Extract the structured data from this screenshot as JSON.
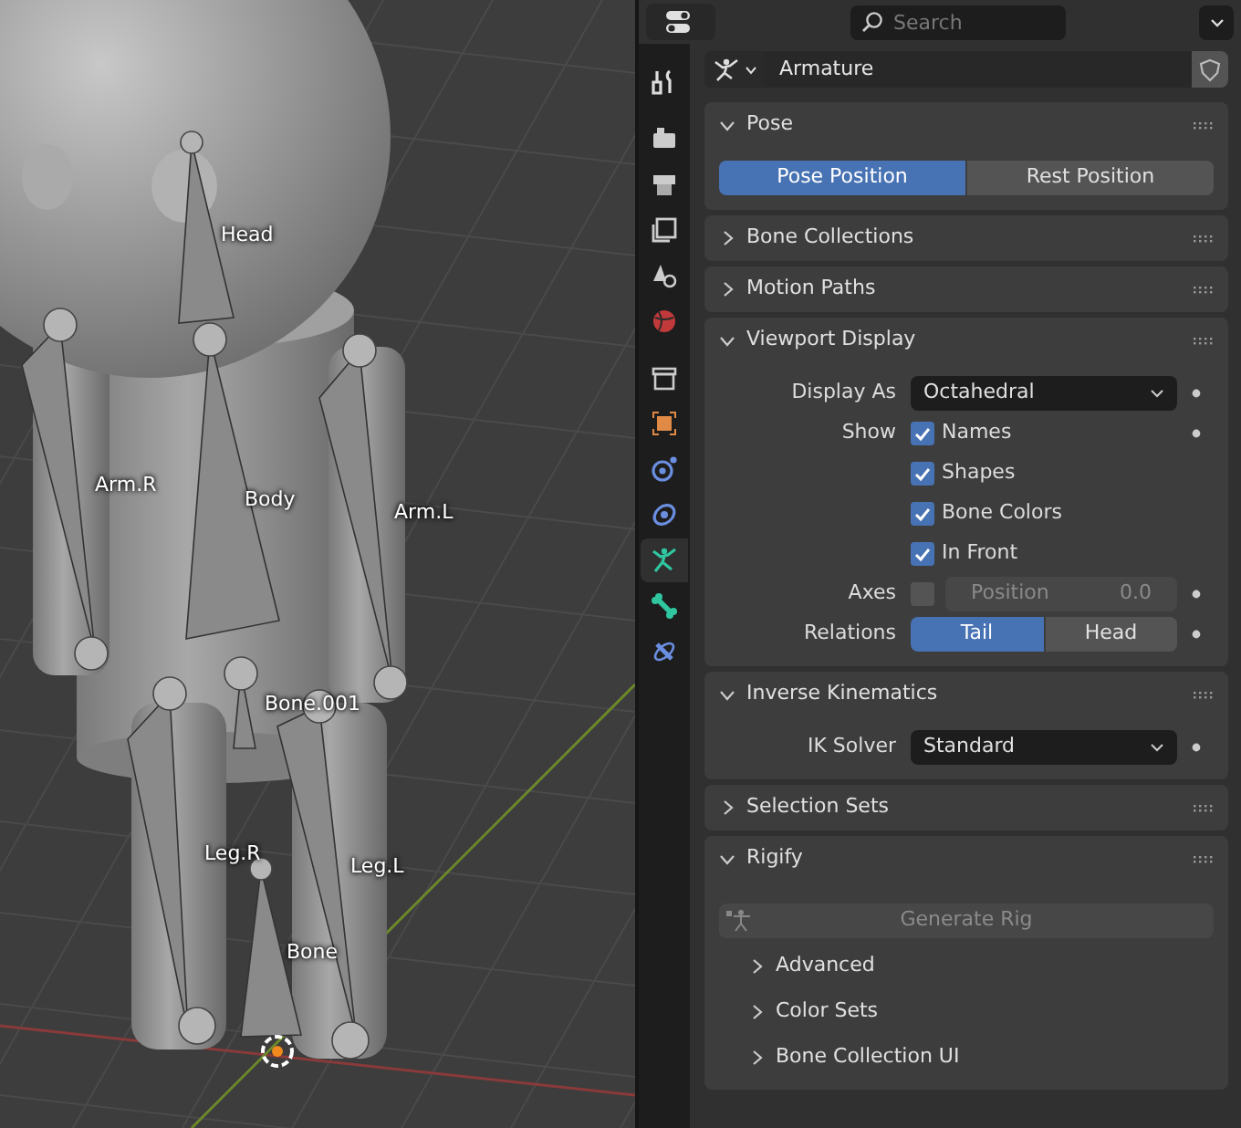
{
  "viewport": {
    "bone_labels": [
      {
        "text": "Head"
      },
      {
        "text": "Arm.R"
      },
      {
        "text": "Body"
      },
      {
        "text": "Arm.L"
      },
      {
        "text": "Bone.001"
      },
      {
        "text": "Leg.R"
      },
      {
        "text": "Leg.L"
      },
      {
        "text": "Bone"
      }
    ]
  },
  "properties": {
    "search_placeholder": "Search",
    "data_block": "Armature",
    "tabs": [
      {
        "kind": "tool",
        "selected": false
      },
      {
        "kind": "render",
        "selected": false
      },
      {
        "kind": "output",
        "selected": false
      },
      {
        "kind": "view_layer",
        "selected": false
      },
      {
        "kind": "scene",
        "selected": false
      },
      {
        "kind": "world",
        "selected": false
      },
      {
        "kind": "collection",
        "selected": false
      },
      {
        "kind": "object",
        "selected": false
      },
      {
        "kind": "physics",
        "selected": false
      },
      {
        "kind": "constraint",
        "selected": false
      },
      {
        "kind": "armature",
        "selected": true
      },
      {
        "kind": "bone",
        "selected": false
      },
      {
        "kind": "bone_constraint",
        "selected": false
      }
    ],
    "panels": [
      {
        "title": "Pose",
        "expanded": true,
        "rows": [
          {
            "kind": "segmented",
            "options": [
              {
                "label": "Pose Position",
                "selected": true
              },
              {
                "label": "Rest Position",
                "selected": false
              }
            ]
          }
        ]
      },
      {
        "title": "Bone Collections",
        "expanded": false
      },
      {
        "title": "Motion Paths",
        "expanded": false
      },
      {
        "title": "Viewport Display",
        "expanded": true,
        "rows": [
          {
            "kind": "dropdown",
            "label": "Display As",
            "value": "Octahedral"
          },
          {
            "kind": "checkbox",
            "label": "Show",
            "text": "Names",
            "checked": true
          },
          {
            "kind": "checkbox",
            "text": "Shapes",
            "checked": true
          },
          {
            "kind": "checkbox",
            "text": "Bone Colors",
            "checked": true
          },
          {
            "kind": "checkbox",
            "text": "In Front",
            "checked": true
          },
          {
            "kind": "axes",
            "label": "Axes",
            "checked": false,
            "field_label": "Position",
            "field_value": "0.0"
          },
          {
            "kind": "segmented",
            "label": "Relations",
            "options": [
              {
                "label": "Tail",
                "selected": true
              },
              {
                "label": "Head",
                "selected": false
              }
            ]
          }
        ]
      },
      {
        "title": "Inverse Kinematics",
        "expanded": true,
        "rows": [
          {
            "kind": "dropdown",
            "label": "IK Solver",
            "value": "Standard"
          }
        ]
      },
      {
        "title": "Selection Sets",
        "expanded": false
      },
      {
        "title": "Rigify",
        "expanded": true,
        "rows": [
          {
            "kind": "button",
            "label": "Generate Rig",
            "disabled": true
          },
          {
            "kind": "subpanel",
            "title": "Advanced",
            "expanded": false
          },
          {
            "kind": "subpanel",
            "title": "Color Sets",
            "expanded": false
          },
          {
            "kind": "subpanel",
            "title": "Bone Collection UI",
            "expanded": false
          }
        ]
      }
    ]
  }
}
